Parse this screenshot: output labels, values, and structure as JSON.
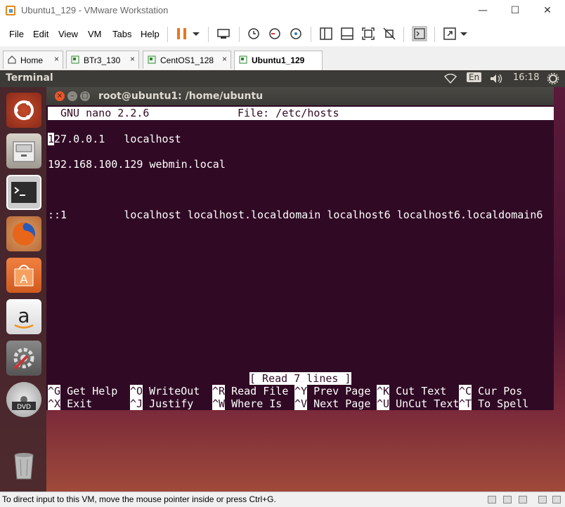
{
  "window": {
    "title": "Ubuntu1_129 - VMware Workstation",
    "controls": {
      "minimize": "—",
      "maximize": "☐",
      "close": "✕"
    }
  },
  "menu": [
    "File",
    "Edit",
    "View",
    "VM",
    "Tabs",
    "Help"
  ],
  "tabs": [
    {
      "label": "Home",
      "icon": "home-icon",
      "active": false
    },
    {
      "label": "BTr3_130",
      "icon": "vm-icon",
      "active": false
    },
    {
      "label": "CentOS1_128",
      "icon": "vm-icon",
      "active": false
    },
    {
      "label": "Ubuntu1_129",
      "icon": "vm-icon",
      "active": true
    }
  ],
  "tab_close": "×",
  "ubuntu_panel": {
    "app_title": "Terminal",
    "keyboard": "En",
    "time": "16:18"
  },
  "terminal": {
    "title": "root@ubuntu1: /home/ubuntu",
    "nano_version": "GNU nano 2.2.6",
    "file_label": "File: /etc/hosts",
    "cursor_char": "1",
    "lines": [
      "27.0.0.1   localhost",
      "192.168.100.129 webmin.local",
      "::1         localhost localhost.localdomain localhost6 localhost6.localdomain6"
    ],
    "status_message": "[ Read 7 lines ]",
    "shortcuts_row1": [
      {
        "key": "^G",
        "label": " Get Help"
      },
      {
        "key": "^O",
        "label": " WriteOut"
      },
      {
        "key": "^R",
        "label": " Read File"
      },
      {
        "key": "^Y",
        "label": " Prev Page"
      },
      {
        "key": "^K",
        "label": " Cut Text"
      },
      {
        "key": "^C",
        "label": " Cur Pos"
      }
    ],
    "shortcuts_row2": [
      {
        "key": "^X",
        "label": " Exit"
      },
      {
        "key": "^J",
        "label": " Justify"
      },
      {
        "key": "^W",
        "label": " Where Is"
      },
      {
        "key": "^V",
        "label": " Next Page"
      },
      {
        "key": "^U",
        "label": " UnCut Text"
      },
      {
        "key": "^T",
        "label": " To Spell"
      }
    ]
  },
  "launcher_icons": [
    "ubuntu-dash-icon",
    "files-icon",
    "terminal-icon",
    "firefox-icon",
    "software-center-icon",
    "amazon-icon",
    "system-settings-icon",
    "dvd-icon",
    "trash-icon"
  ],
  "statusbar": {
    "text": "To direct input to this VM, move the mouse pointer inside or press Ctrl+G."
  },
  "colors": {
    "terminal_bg": "#300a24",
    "panel_bg": "#3c3b37",
    "pause_orange": "#e87722"
  }
}
